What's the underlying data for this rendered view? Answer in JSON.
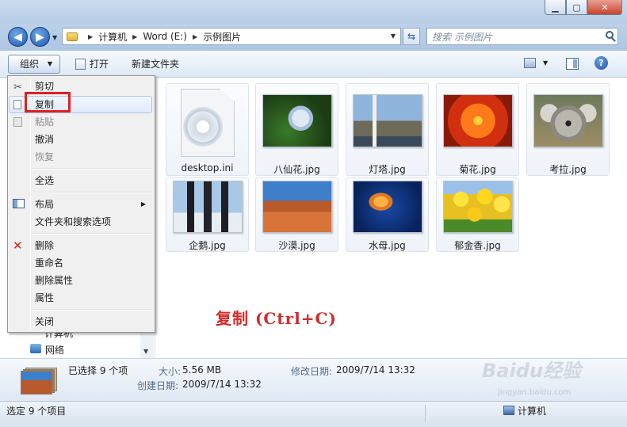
{
  "window": {
    "min_icon": "minimize-icon",
    "max_icon": "maximize-icon",
    "close_icon": "close-icon"
  },
  "address": {
    "breadcrumb": [
      "计算机",
      "Word (E:)",
      "示例图片"
    ],
    "search_placeholder": "搜索 示例图片"
  },
  "toolbar": {
    "organize": "组织",
    "open": "打开",
    "new_folder": "新建文件夹"
  },
  "nav": {
    "computer": "计算机",
    "network": "网络"
  },
  "context_menu": {
    "items": [
      {
        "label": "剪切",
        "icon": "scissors-icon",
        "state": "normal"
      },
      {
        "label": "复制",
        "icon": "copy-icon",
        "state": "highlighted"
      },
      {
        "label": "粘贴",
        "icon": "paste-icon",
        "state": "disabled"
      },
      {
        "label": "撤消",
        "icon": "",
        "state": "normal"
      },
      {
        "label": "恢复",
        "icon": "",
        "state": "disabled"
      },
      {
        "label": "全选",
        "icon": "",
        "state": "normal"
      },
      {
        "label": "布局",
        "icon": "layout-icon",
        "state": "submenu"
      },
      {
        "label": "文件夹和搜索选项",
        "icon": "",
        "state": "normal"
      },
      {
        "label": "删除",
        "icon": "delete-x-icon",
        "state": "normal"
      },
      {
        "label": "重命名",
        "icon": "",
        "state": "normal"
      },
      {
        "label": "删除属性",
        "icon": "",
        "state": "normal"
      },
      {
        "label": "属性",
        "icon": "",
        "state": "normal"
      },
      {
        "label": "关闭",
        "icon": "",
        "state": "normal"
      }
    ]
  },
  "files": [
    {
      "name": "desktop.ini",
      "kind": "settings-file-icon"
    },
    {
      "name": "八仙花.jpg",
      "kind": "hydrangea-photo"
    },
    {
      "name": "灯塔.jpg",
      "kind": "lighthouse-photo"
    },
    {
      "name": "菊花.jpg",
      "kind": "chrysanthemum-photo"
    },
    {
      "name": "考拉.jpg",
      "kind": "koala-photo"
    },
    {
      "name": "企鹅.jpg",
      "kind": "penguins-photo"
    },
    {
      "name": "沙漠.jpg",
      "kind": "desert-photo"
    },
    {
      "name": "水母.jpg",
      "kind": "jellyfish-photo"
    },
    {
      "name": "郁金香.jpg",
      "kind": "tulips-photo"
    }
  ],
  "annotation": "复制 (Ctrl+C)",
  "details": {
    "selected": "已选择 9 个项",
    "size_label": "大小:",
    "size_value": "5.56 MB",
    "modified_label": "修改日期:",
    "modified_value": "2009/7/14 13:32",
    "created_label": "创建日期:",
    "created_value": "2009/7/14 13:32"
  },
  "status": {
    "left": "选定 9 个项目",
    "right": "计算机"
  },
  "watermark": {
    "brand": "Baidu经验",
    "url": "jingyan.baidu.com"
  },
  "colors": {
    "highlight_box": "#e02020",
    "annotation": "#d12a2a",
    "accent": "#1c58b0"
  }
}
